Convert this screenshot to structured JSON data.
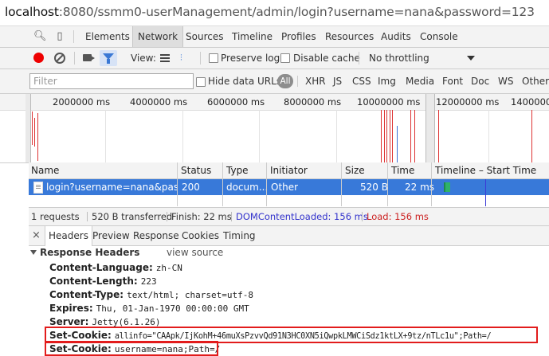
{
  "url": {
    "host": "localhost",
    "rest": ":8080/ssmm0-userManagement/admin/login?username=nana&password=123"
  },
  "devtools": {
    "tabs": [
      "Elements",
      "Network",
      "Sources",
      "Timeline",
      "Profiles",
      "Resources",
      "Audits",
      "Console"
    ],
    "active_tab": "Network"
  },
  "toolbar": {
    "view_label": "View:",
    "preserve_log": "Preserve log",
    "disable_cache": "Disable cache",
    "throttling": "No throttling"
  },
  "filterbar": {
    "placeholder": "Filter",
    "hide_data_urls": "Hide data URLs",
    "all": "All",
    "types": [
      "XHR",
      "JS",
      "CSS",
      "Img",
      "Media",
      "Font",
      "Doc",
      "WS",
      "Other"
    ]
  },
  "overview": {
    "ticks": [
      "2000000 ms",
      "4000000 ms",
      "6000000 ms",
      "8000000 ms",
      "10000000 ms",
      "12000000 ms",
      "14000000"
    ]
  },
  "table": {
    "headers": [
      "Name",
      "Status",
      "Type",
      "Initiator",
      "Size",
      "Time",
      "Timeline – Start Time"
    ],
    "rows": [
      {
        "name": "login?username=nana&pass...",
        "status": "200",
        "type": "docum...",
        "initiator": "Other",
        "size": "520 B",
        "time": "22 ms"
      }
    ]
  },
  "status": {
    "requests": "1 requests",
    "transferred": "520 B transferred",
    "finish": "Finish: 22 ms",
    "domcontent": "DOMContentLoaded: 156 ms",
    "load": "Load: 156 ms",
    "domcontent_color": "#3333cc",
    "load_color": "#cc2222"
  },
  "details": {
    "close": "×",
    "tabs": [
      "Headers",
      "Preview",
      "Response",
      "Cookies",
      "Timing"
    ],
    "active_tab": "Headers"
  },
  "response_headers": {
    "title": "Response Headers",
    "view_source": "view source",
    "items": [
      {
        "key": "Content-Language:",
        "value": "zh-CN"
      },
      {
        "key": "Content-Length:",
        "value": "223"
      },
      {
        "key": "Content-Type:",
        "value": "text/html; charset=utf-8"
      },
      {
        "key": "Expires:",
        "value": "Thu, 01-Jan-1970 00:00:00 GMT"
      },
      {
        "key": "Server:",
        "value": "Jetty(6.1.26)"
      },
      {
        "key": "Set-Cookie:",
        "value": "allinfo=\"CAApk/IjKohM+46muXsPzvvQd91N3HC0XN5iQwpkLMWCiSdz1ktLX+9tz/nTLc1u\";Path=/"
      },
      {
        "key": "Set-Cookie:",
        "value": "username=nana;Path=/"
      }
    ],
    "highlight_color": "#e21c1c"
  }
}
